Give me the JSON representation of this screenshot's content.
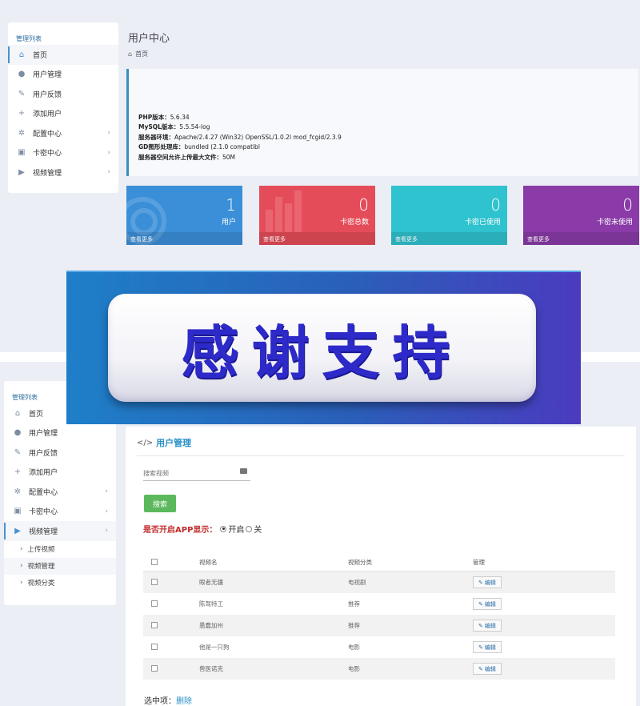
{
  "sidebar_top": {
    "title": "管理列表",
    "items": [
      {
        "label": "首页",
        "icon": "home-icon",
        "active": true
      },
      {
        "label": "用户管理",
        "icon": "user-icon"
      },
      {
        "label": "用户反馈",
        "icon": "edit-icon"
      },
      {
        "label": "添加用户",
        "icon": "add-user-icon"
      },
      {
        "label": "配置中心",
        "icon": "gear-icon",
        "expandable": true
      },
      {
        "label": "卡密中心",
        "icon": "card-icon",
        "expandable": true
      },
      {
        "label": "视频管理",
        "icon": "play-icon",
        "expandable": true
      }
    ]
  },
  "header": {
    "title": "用户中心",
    "breadcrumb": "首页"
  },
  "server_info": [
    {
      "label": "PHP版本：",
      "value": "5.6.34"
    },
    {
      "label": "MySQL版本：",
      "value": "5.5.54-log"
    },
    {
      "label": "服务器环境：",
      "value": "Apache/2.4.27 (Win32) OpenSSL/1.0.2l mod_fcgid/2.3.9"
    },
    {
      "label": "GD图形处理库：",
      "value": "bundled (2.1.0 compatibl"
    },
    {
      "label": "服务器空间允许上传最大文件：",
      "value": "50M"
    }
  ],
  "stats": [
    {
      "value": "1",
      "label": "用户",
      "more": "查看更多",
      "color": "#3a8fd8"
    },
    {
      "value": "0",
      "label": "卡密总数",
      "more": "查看更多",
      "color": "#e54c59"
    },
    {
      "value": "0",
      "label": "卡密已使用",
      "more": "查看更多",
      "color": "#2fc2cf"
    },
    {
      "value": "0",
      "label": "卡密未使用",
      "more": "查看更多",
      "color": "#8a3ba8"
    }
  ],
  "banner": {
    "text": "感谢支持"
  },
  "sidebar_bottom": {
    "title": "管理列表",
    "items": [
      {
        "label": "首页",
        "icon": "home-icon"
      },
      {
        "label": "用户管理",
        "icon": "user-icon"
      },
      {
        "label": "用户反馈",
        "icon": "edit-icon"
      },
      {
        "label": "添加用户",
        "icon": "add-user-icon"
      },
      {
        "label": "配置中心",
        "icon": "gear-icon",
        "expandable": true
      },
      {
        "label": "卡密中心",
        "icon": "card-icon",
        "expandable": true
      },
      {
        "label": "视频管理",
        "icon": "play-icon",
        "expandable": true,
        "active": true
      }
    ],
    "subitems": [
      {
        "label": "上传视频"
      },
      {
        "label": "视频管理",
        "active": true
      },
      {
        "label": "视频分类"
      }
    ]
  },
  "video_page": {
    "title_icon": "</>",
    "title": "用户管理",
    "search_placeholder": "搜索视频",
    "search_button": "搜索",
    "app_question": "是否开启APP显示：",
    "radio_on": "开启",
    "radio_off": "关",
    "columns": [
      "视频名",
      "视频分类",
      "管理"
    ],
    "rows": [
      {
        "name": "眼者无疆",
        "category": "电视剧",
        "action": "编辑"
      },
      {
        "name": "陈驾特工",
        "category": "推荐",
        "action": "编辑"
      },
      {
        "name": "愚蠢加州",
        "category": "推荐",
        "action": "编辑"
      },
      {
        "name": "他是一只狗",
        "category": "电影",
        "action": "编辑"
      },
      {
        "name": "兽医诺克",
        "category": "电影",
        "action": "编辑"
      }
    ],
    "selected_label": "选中项：",
    "delete_label": "删除"
  }
}
